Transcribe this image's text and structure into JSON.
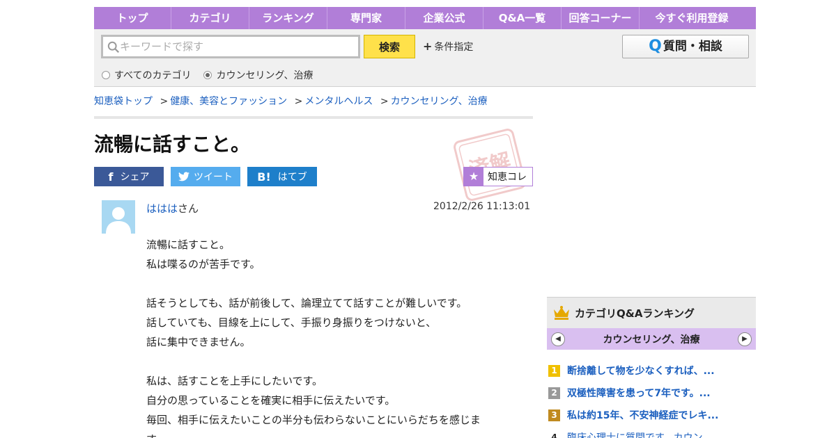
{
  "nav": {
    "items": [
      "トップ",
      "カテゴリ",
      "ランキング",
      "専門家",
      "企業公式",
      "Q&A一覧",
      "回答コーナー",
      "今すぐ利用登録"
    ]
  },
  "search": {
    "placeholder": "キーワードで探す",
    "button_label": "検索",
    "condition_label": "条件指定",
    "ask_button_label": "質問・相談",
    "radio_all": "すべてのカテゴリ",
    "radio_current": "カウンセリング、治療"
  },
  "breadcrumb": {
    "items": [
      "知恵袋トップ",
      "健康、美容とファッション",
      "メンタルヘルス",
      "カウンセリング、治療"
    ]
  },
  "question": {
    "title": "流暢に話すこと。",
    "stamp_text": "済解",
    "share": {
      "facebook": "シェア",
      "twitter": "ツイート",
      "hatena": "はてブ",
      "hatena_icon": "B!"
    },
    "chiecore_label": "知恵コレ",
    "user_name": "ははは",
    "user_suffix": "さん",
    "datetime": "2012/2/26  11:13:01",
    "body_lines": [
      "流暢に話すこと。",
      "私は喋るのが苦手です。",
      "",
      "話そうとしても、話が前後して、論理立てて話すことが難しいです。",
      "話していても、目線を上にして、手振り身振りをつけないと、",
      "話に集中できません。",
      "",
      "私は、話すことを上手にしたいです。",
      "自分の思っていることを確実に相手に伝えたいです。",
      "毎回、相手に伝えたいことの半分も伝わらないことにいらだちを感じま",
      "す。"
    ]
  },
  "ranking": {
    "title": "カテゴリQ&Aランキング",
    "category": "カウンセリング、治療",
    "items": [
      {
        "rank": "1",
        "text": "断捨離して物を少なくすれば、...",
        "color": "#f0c000"
      },
      {
        "rank": "2",
        "text": "双極性障害を患って7年です。...",
        "color": "#999999"
      },
      {
        "rank": "3",
        "text": "私は約15年、不安神経症でレキ...",
        "color": "#c08a20"
      },
      {
        "rank": "4",
        "text": "臨床心理士に質問です。カウン...",
        "color": ""
      }
    ]
  },
  "colors": {
    "nav_purple": "#b17ed8",
    "search_yellow": "#ffe14a",
    "link_blue": "#1b5fbf"
  }
}
